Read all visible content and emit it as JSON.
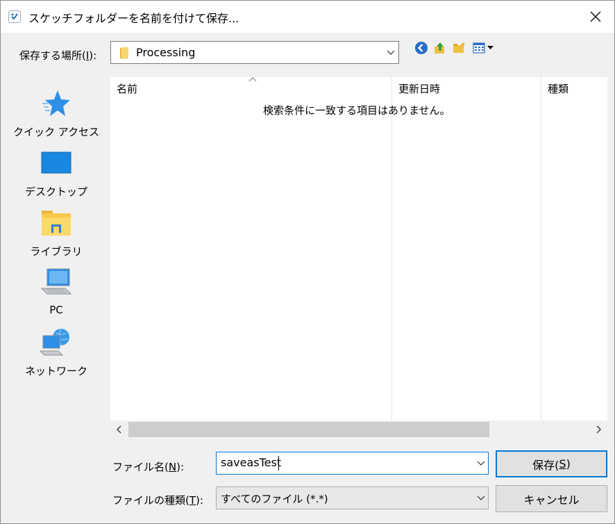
{
  "window": {
    "title": "スケッチフォルダーを名前を付けて保存..."
  },
  "save_in": {
    "label_pre": "保存する場所(",
    "label_key": "I",
    "label_post": "):",
    "value": "Processing"
  },
  "places": [
    {
      "label": "クイック アクセス"
    },
    {
      "label": "デスクトップ"
    },
    {
      "label": "ライブラリ"
    },
    {
      "label": "PC"
    },
    {
      "label": "ネットワーク"
    }
  ],
  "file_list": {
    "columns": [
      "名前",
      "更新日時",
      "種類"
    ],
    "empty_message": "検索条件に一致する項目はありません。"
  },
  "file_name": {
    "label_pre": "ファイル名(",
    "label_key": "N",
    "label_post": "):",
    "value": "saveasTest"
  },
  "file_type": {
    "label_pre": "ファイルの種類(",
    "label_key": "T",
    "label_post": "):",
    "value": "すべてのファイル (*.*)"
  },
  "buttons": {
    "save_pre": "保存(",
    "save_key": "S",
    "save_post": ")",
    "cancel": "キャンセル"
  },
  "colors": {
    "accent": "#0078d7",
    "folder": "#f8d775",
    "back_button": "#2b6ec4"
  }
}
